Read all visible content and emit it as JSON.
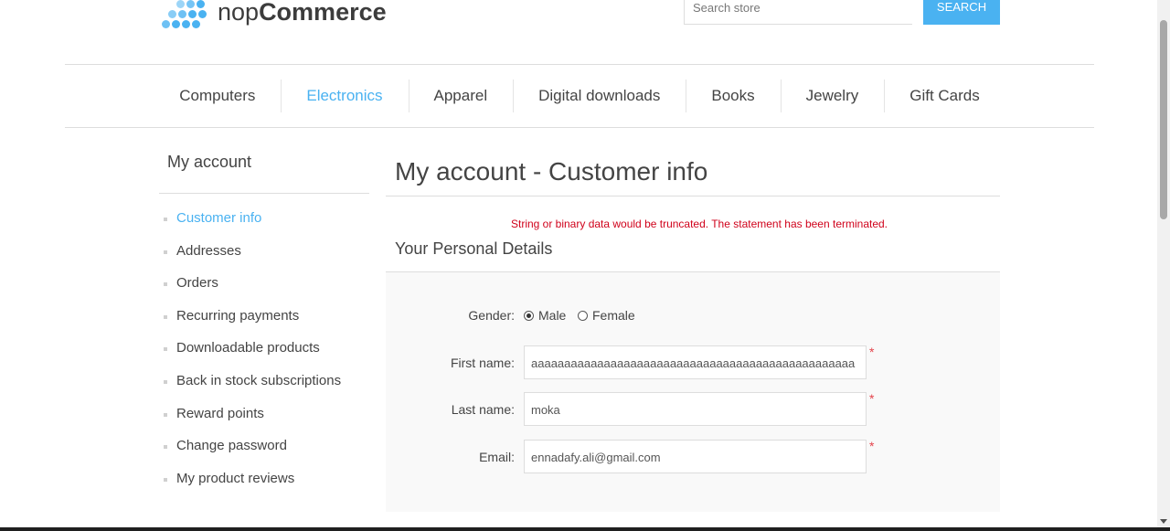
{
  "header": {
    "logo": {
      "prefix": "nop",
      "brand": "Commerce",
      "icon": "dot-grid-logo-icon"
    },
    "search": {
      "placeholder": "Search store",
      "button_label": "SEARCH"
    }
  },
  "menu": {
    "items": [
      {
        "label": "Computers"
      },
      {
        "label": "Electronics"
      },
      {
        "label": "Apparel"
      },
      {
        "label": "Digital downloads"
      },
      {
        "label": "Books"
      },
      {
        "label": "Jewelry"
      },
      {
        "label": "Gift Cards"
      }
    ],
    "active_index": 1
  },
  "sidebar": {
    "title": "My account",
    "items": [
      {
        "label": "Customer info"
      },
      {
        "label": "Addresses"
      },
      {
        "label": "Orders"
      },
      {
        "label": "Recurring payments"
      },
      {
        "label": "Downloadable products"
      },
      {
        "label": "Back in stock subscriptions"
      },
      {
        "label": "Reward points"
      },
      {
        "label": "Change password"
      },
      {
        "label": "My product reviews"
      }
    ],
    "active_index": 0
  },
  "main": {
    "page_title": "My account - Customer info",
    "error_message": "String or binary data would be truncated. The statement has been terminated.",
    "section_title": "Your Personal Details",
    "form": {
      "gender": {
        "label": "Gender:",
        "options": [
          "Male",
          "Female"
        ],
        "selected": "Male"
      },
      "first_name": {
        "label": "First name:",
        "value": "aaaaaaaaaaaaaaaaaaaaaaaaaaaaaaaaaaaaaaaaaaaaaaaaa",
        "required_mark": "*"
      },
      "last_name": {
        "label": "Last name:",
        "value": "moka",
        "required_mark": "*"
      },
      "email": {
        "label": "Email:",
        "value": "ennadafy.ali@gmail.com",
        "required_mark": "*"
      }
    }
  },
  "colors": {
    "accent": "#4ab2f1",
    "error": "#d0021b",
    "required": "#e4444c",
    "text": "#444444",
    "panel": "#f9f9f9"
  }
}
